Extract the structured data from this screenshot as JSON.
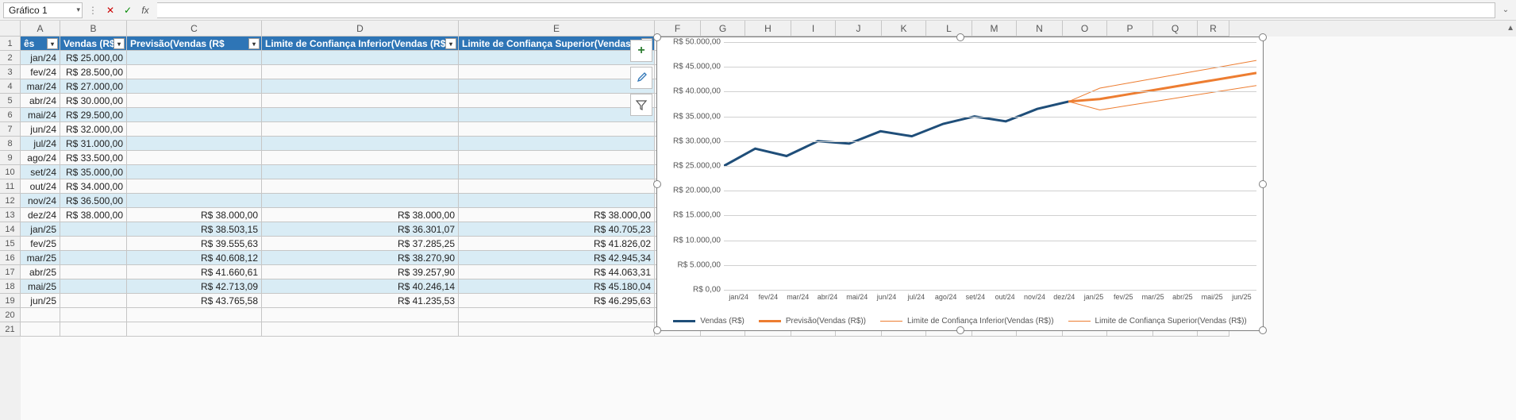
{
  "top": {
    "name_box": "Gráfico 1",
    "fx_label": "fx",
    "formula": ""
  },
  "columns": [
    "A",
    "B",
    "C",
    "D",
    "E",
    "F",
    "G",
    "H",
    "I",
    "J",
    "K",
    "L",
    "M",
    "N",
    "O",
    "P",
    "Q",
    "R"
  ],
  "row_numbers": [
    1,
    2,
    3,
    4,
    5,
    6,
    7,
    8,
    9,
    10,
    11,
    12,
    13,
    14,
    15,
    16,
    17,
    18,
    19,
    20,
    21
  ],
  "headers": {
    "a": "ês",
    "b": "Vendas (R$",
    "c": "Previsão(Vendas (R$",
    "d": "Limite de Confiança Inferior(Vendas (R$",
    "e": "Limite de Confiança Superior(Vendas (R"
  },
  "table": [
    {
      "m": "jan/24",
      "v": "R$ 25.000,00"
    },
    {
      "m": "fev/24",
      "v": "R$ 28.500,00"
    },
    {
      "m": "mar/24",
      "v": "R$ 27.000,00"
    },
    {
      "m": "abr/24",
      "v": "R$ 30.000,00"
    },
    {
      "m": "mai/24",
      "v": "R$ 29.500,00"
    },
    {
      "m": "jun/24",
      "v": "R$ 32.000,00"
    },
    {
      "m": "jul/24",
      "v": "R$ 31.000,00"
    },
    {
      "m": "ago/24",
      "v": "R$ 33.500,00"
    },
    {
      "m": "set/24",
      "v": "R$ 35.000,00"
    },
    {
      "m": "out/24",
      "v": "R$ 34.000,00"
    },
    {
      "m": "nov/24",
      "v": "R$ 36.500,00"
    },
    {
      "m": "dez/24",
      "v": "R$ 38.000,00",
      "p": "R$ 38.000,00",
      "li": "R$ 38.000,00",
      "ls": "R$ 38.000,00"
    },
    {
      "m": "jan/25",
      "p": "R$ 38.503,15",
      "li": "R$ 36.301,07",
      "ls": "R$ 40.705,23"
    },
    {
      "m": "fev/25",
      "p": "R$ 39.555,63",
      "li": "R$ 37.285,25",
      "ls": "R$ 41.826,02"
    },
    {
      "m": "mar/25",
      "p": "R$ 40.608,12",
      "li": "R$ 38.270,90",
      "ls": "R$ 42.945,34"
    },
    {
      "m": "abr/25",
      "p": "R$ 41.660,61",
      "li": "R$ 39.257,90",
      "ls": "R$ 44.063,31"
    },
    {
      "m": "mai/25",
      "p": "R$ 42.713,09",
      "li": "R$ 40.246,14",
      "ls": "R$ 45.180,04"
    },
    {
      "m": "jun/25",
      "p": "R$ 43.765,58",
      "li": "R$ 41.235,53",
      "ls": "R$ 46.295,63"
    }
  ],
  "chart_data": {
    "type": "line",
    "title": "",
    "xlabel": "",
    "ylabel": "",
    "ylim": [
      0,
      50000
    ],
    "yticks": [
      "R$ 0,00",
      "R$ 5.000,00",
      "R$ 10.000,00",
      "R$ 15.000,00",
      "R$ 20.000,00",
      "R$ 25.000,00",
      "R$ 30.000,00",
      "R$ 35.000,00",
      "R$ 40.000,00",
      "R$ 45.000,00",
      "R$ 50.000,00"
    ],
    "categories": [
      "jan/24",
      "fev/24",
      "mar/24",
      "abr/24",
      "mai/24",
      "jun/24",
      "jul/24",
      "ago/24",
      "set/24",
      "out/24",
      "nov/24",
      "dez/24",
      "jan/25",
      "fev/25",
      "mar/25",
      "abr/25",
      "mai/25",
      "jun/25"
    ],
    "series": [
      {
        "name": "Vendas (R$)",
        "color": "#1f4e79",
        "width": 3,
        "values": [
          25000,
          28500,
          27000,
          30000,
          29500,
          32000,
          31000,
          33500,
          35000,
          34000,
          36500,
          38000,
          null,
          null,
          null,
          null,
          null,
          null
        ]
      },
      {
        "name": "Previsão(Vendas (R$))",
        "color": "#ed7d31",
        "width": 3,
        "values": [
          null,
          null,
          null,
          null,
          null,
          null,
          null,
          null,
          null,
          null,
          null,
          38000,
          38503.15,
          39555.63,
          40608.12,
          41660.61,
          42713.09,
          43765.58
        ]
      },
      {
        "name": "Limite de Confiança Inferior(Vendas (R$))",
        "color": "#ed7d31",
        "width": 1,
        "values": [
          null,
          null,
          null,
          null,
          null,
          null,
          null,
          null,
          null,
          null,
          null,
          38000,
          36301.07,
          37285.25,
          38270.9,
          39257.9,
          40246.14,
          41235.53
        ]
      },
      {
        "name": "Limite de Confiança Superior(Vendas (R$))",
        "color": "#ed7d31",
        "width": 1,
        "values": [
          null,
          null,
          null,
          null,
          null,
          null,
          null,
          null,
          null,
          null,
          null,
          38000,
          40705.23,
          41826.02,
          42945.34,
          44063.31,
          45180.04,
          46295.63
        ]
      }
    ],
    "legend": [
      "Vendas (R$)",
      "Previsão(Vendas (R$))",
      "Limite de Confiança Inferior(Vendas (R$))",
      "Limite de Confiança Superior(Vendas (R$))"
    ]
  },
  "side_buttons": {
    "plus": "+",
    "brush": "",
    "filter": ""
  }
}
